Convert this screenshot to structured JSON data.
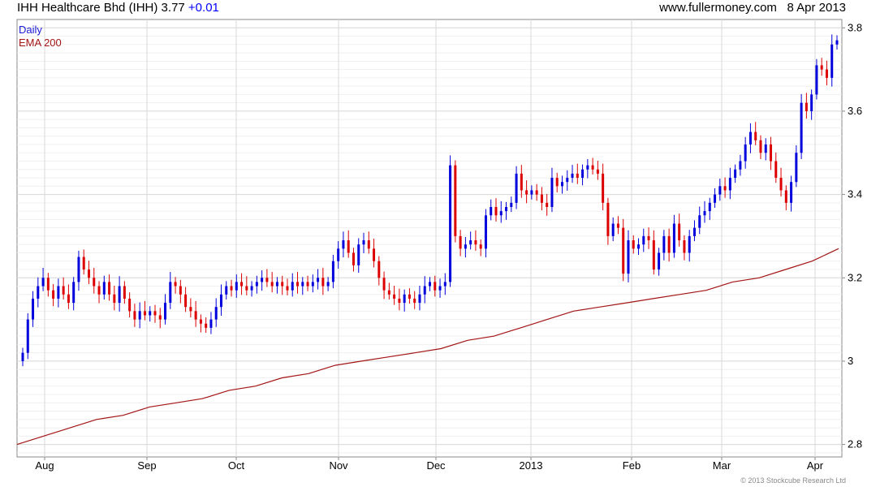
{
  "header": {
    "title": "IHH Healthcare Bhd (IHH) 3.77",
    "change": "+0.01",
    "source": "www.fullermoney.com",
    "date": "8 Apr 2013"
  },
  "copyright": "© 2013 Stockcube Research Ltd",
  "colors": {
    "up": "#0000dd",
    "down": "#dd0000",
    "ema": "#a31515",
    "grid": "#d9d9d9"
  },
  "chart_data": {
    "type": "candlestick",
    "y_range": [
      2.77,
      3.82
    ],
    "y_ticks": [
      "2.8",
      "3",
      "3.2",
      "3.4",
      "3.6",
      "3.8"
    ],
    "x_ticks": [
      "Aug",
      "Sep",
      "Oct",
      "Nov",
      "Dec",
      "2013",
      "Feb",
      "Mar",
      "Apr"
    ],
    "legend": [
      "Daily",
      "EMA 200"
    ],
    "grid": true,
    "series": [
      {
        "name": "Daily",
        "closes": [
          3.02,
          3.1,
          3.15,
          3.18,
          3.2,
          3.17,
          3.15,
          3.18,
          3.16,
          3.14,
          3.19,
          3.25,
          3.22,
          3.2,
          3.18,
          3.16,
          3.19,
          3.16,
          3.14,
          3.18,
          3.15,
          3.12,
          3.1,
          3.12,
          3.11,
          3.12,
          3.11,
          3.1,
          3.14,
          3.19,
          3.18,
          3.16,
          3.13,
          3.12,
          3.1,
          3.09,
          3.08,
          3.1,
          3.13,
          3.16,
          3.18,
          3.17,
          3.19,
          3.18,
          3.17,
          3.18,
          3.19,
          3.2,
          3.19,
          3.18,
          3.19,
          3.18,
          3.17,
          3.19,
          3.18,
          3.19,
          3.18,
          3.19,
          3.2,
          3.18,
          3.19,
          3.24,
          3.27,
          3.29,
          3.26,
          3.23,
          3.28,
          3.29,
          3.27,
          3.24,
          3.2,
          3.17,
          3.16,
          3.15,
          3.14,
          3.16,
          3.15,
          3.14,
          3.16,
          3.18,
          3.19,
          3.17,
          3.18,
          3.19,
          3.47,
          3.3,
          3.27,
          3.28,
          3.29,
          3.28,
          3.27,
          3.35,
          3.37,
          3.35,
          3.36,
          3.37,
          3.38,
          3.45,
          3.41,
          3.4,
          3.41,
          3.4,
          3.38,
          3.37,
          3.44,
          3.42,
          3.43,
          3.44,
          3.45,
          3.44,
          3.46,
          3.47,
          3.46,
          3.45,
          3.38,
          3.3,
          3.33,
          3.32,
          3.21,
          3.29,
          3.27,
          3.28,
          3.3,
          3.29,
          3.22,
          3.26,
          3.3,
          3.26,
          3.33,
          3.29,
          3.26,
          3.3,
          3.32,
          3.35,
          3.36,
          3.38,
          3.4,
          3.42,
          3.41,
          3.44,
          3.46,
          3.48,
          3.52,
          3.55,
          3.53,
          3.5,
          3.52,
          3.48,
          3.44,
          3.41,
          3.38,
          3.43,
          3.5,
          3.62,
          3.6,
          3.64,
          3.71,
          3.7,
          3.68,
          3.76,
          3.77
        ]
      },
      {
        "name": "EMA 200",
        "values": [
          2.8,
          2.82,
          2.84,
          2.86,
          2.87,
          2.89,
          2.9,
          2.91,
          2.93,
          2.94,
          2.96,
          2.97,
          2.99,
          3.0,
          3.01,
          3.02,
          3.03,
          3.05,
          3.06,
          3.08,
          3.1,
          3.12,
          3.13,
          3.14,
          3.15,
          3.16,
          3.17,
          3.19,
          3.2,
          3.22,
          3.24,
          3.27
        ]
      }
    ]
  }
}
